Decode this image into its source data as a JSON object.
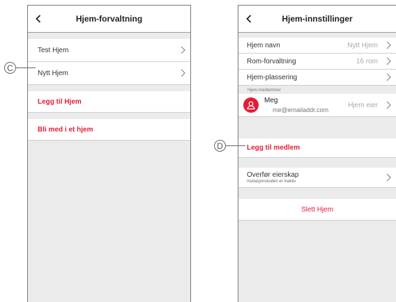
{
  "left_screen": {
    "title": "Hjem-forvaltning",
    "homes": [
      {
        "label": "Test Hjem"
      },
      {
        "label": "Nytt Hjem"
      }
    ],
    "add_home": "Legg til Hjem",
    "join_home": "Bli med i et hjem"
  },
  "right_screen": {
    "title": "Hjem-innstillinger",
    "settings": [
      {
        "label": "Hjem navn",
        "value": "Nytt Hjem"
      },
      {
        "label": "Rom-forvaltning",
        "value": "16 rom"
      },
      {
        "label": "Hjem-plassering",
        "value": ""
      }
    ],
    "members_header": "Hjem-medlemmer",
    "member": {
      "name": "Meg",
      "email": "me@emailaddr.com",
      "role": "Hjem eier"
    },
    "add_member": "Legg til medlem",
    "transfer": {
      "label": "Overfør eierskap",
      "sublabel": "Invitasjonskoden er inaktiv"
    },
    "delete_home": "Slett Hjem"
  },
  "callouts": {
    "c": "C",
    "d": "D"
  },
  "colors": {
    "accent": "#e01e37",
    "background": "#ebebeb",
    "border": "#777777"
  }
}
